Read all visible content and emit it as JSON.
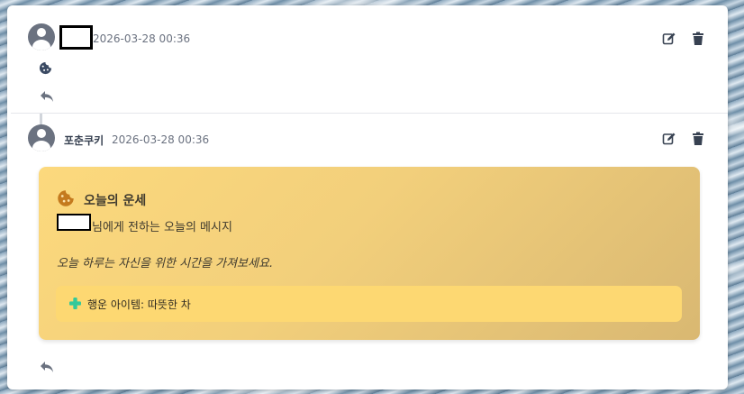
{
  "comments": [
    {
      "timestamp": "2026-03-28 00:36",
      "icon": "cookie-icon",
      "actions": [
        "edit-icon",
        "trash-icon"
      ],
      "reply_icon": "reply-icon"
    },
    {
      "author": "포춘쿠키",
      "timestamp": "2026-03-28 00:36",
      "actions": [
        "edit-icon",
        "trash-icon"
      ],
      "reply_icon": "reply-icon",
      "fortune": {
        "title": "오늘의 운세",
        "subtitle": "님에게 전하는 오늘의 메시지",
        "message": "오늘 하루는 자신을 위한 시간을 가져보세요.",
        "lucky_item": "행운 아이템: 따뜻한 차",
        "colors": {
          "card": "#f7d37c",
          "lucky_box": "#fdd872",
          "cookie": "#c47a1e",
          "clover": "#34c99a"
        }
      }
    }
  ],
  "colors": {
    "icon": "#374151",
    "muted": "#6b7280"
  }
}
